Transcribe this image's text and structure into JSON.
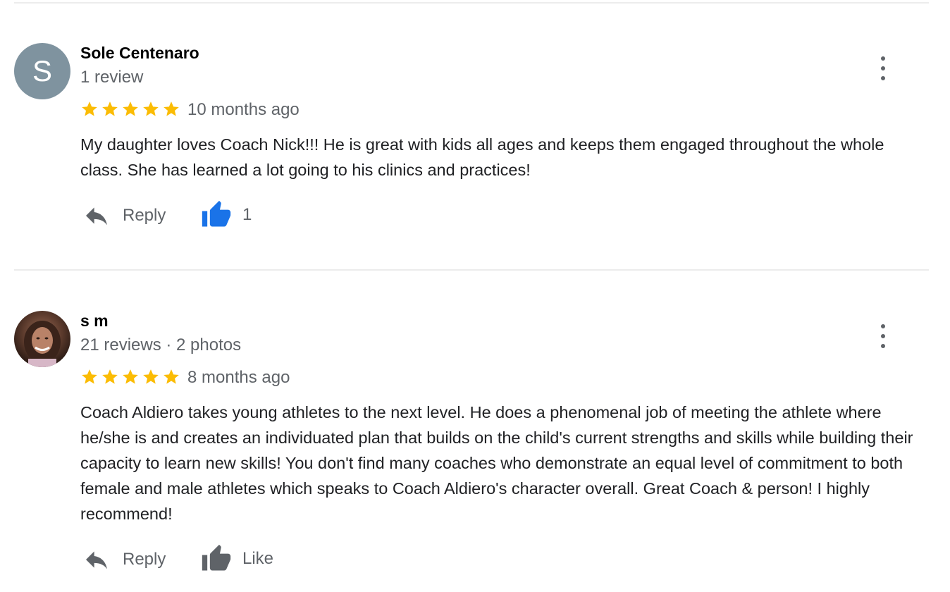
{
  "reviews": [
    {
      "author": "Sole Centenaro",
      "avatar_letter": "S",
      "meta": "1 review",
      "rating": 5,
      "time": "10 months ago",
      "text": "My daughter loves Coach Nick!!! He is great with kids all ages and keeps them engaged throughout the whole class. She has learned a lot going to his clinics and practices!",
      "reply_label": "Reply",
      "like_label": "1",
      "liked": true
    },
    {
      "author": "s m",
      "avatar_letter": "",
      "meta": "21 reviews · 2 photos",
      "rating": 5,
      "time": "8 months ago",
      "text": "Coach Aldiero takes young athletes to the next level. He does a phenomenal job of meeting the athlete where he/she is and creates an individuated plan that builds on the child's current strengths and skills while building their capacity to learn new skills! You don't find many coaches who demonstrate an equal level of commitment to both female and male athletes which speaks to Coach Aldiero's character overall. Great Coach & person! I highly recommend!",
      "reply_label": "Reply",
      "like_label": "Like",
      "liked": false
    }
  ],
  "icons": {
    "star": "star-icon",
    "more": "more-vert-icon",
    "reply": "reply-icon",
    "like": "thumb-up-icon"
  },
  "colors": {
    "star": "#fbbc04",
    "liked": "#1a73e8",
    "icon_gray": "#5f6368",
    "avatar_bg": "#7f939f"
  }
}
